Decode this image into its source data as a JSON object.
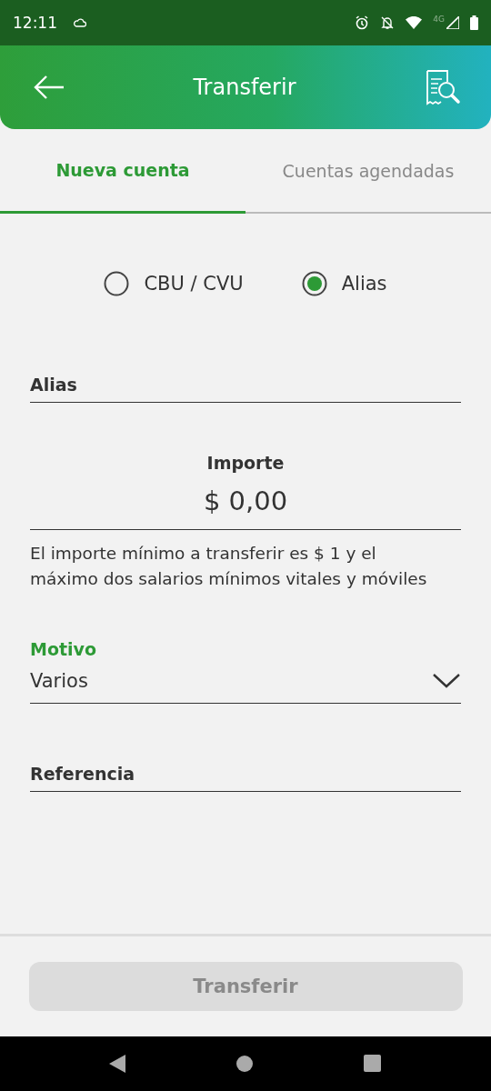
{
  "status_bar": {
    "time": "12:11",
    "network": "4G"
  },
  "header": {
    "title": "Transferir"
  },
  "tabs": [
    {
      "label": "Nueva cuenta",
      "selected": true
    },
    {
      "label": "Cuentas agendadas",
      "selected": false
    }
  ],
  "account_type": [
    {
      "label": "CBU / CVU",
      "selected": false
    },
    {
      "label": "Alias",
      "selected": true
    }
  ],
  "alias_field": {
    "placeholder": "Alias"
  },
  "amount": {
    "label": "Importe",
    "value": "$ 0,00",
    "hint": "El importe mínimo a transferir es $ 1 y  el máximo dos salarios mínimos vitales y móviles"
  },
  "motivo": {
    "label": "Motivo",
    "value": "Varios"
  },
  "reference_field": {
    "placeholder": "Referencia"
  },
  "submit_button": {
    "label": "Transferir",
    "disabled": true
  }
}
